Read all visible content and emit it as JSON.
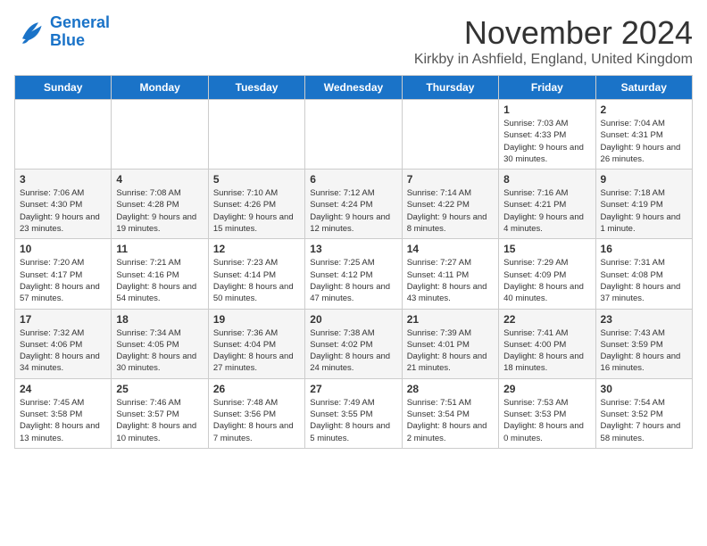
{
  "logo": {
    "line1": "General",
    "line2": "Blue"
  },
  "title": "November 2024",
  "subtitle": "Kirkby in Ashfield, England, United Kingdom",
  "days_of_week": [
    "Sunday",
    "Monday",
    "Tuesday",
    "Wednesday",
    "Thursday",
    "Friday",
    "Saturday"
  ],
  "weeks": [
    [
      {
        "day": "",
        "info": ""
      },
      {
        "day": "",
        "info": ""
      },
      {
        "day": "",
        "info": ""
      },
      {
        "day": "",
        "info": ""
      },
      {
        "day": "",
        "info": ""
      },
      {
        "day": "1",
        "info": "Sunrise: 7:03 AM\nSunset: 4:33 PM\nDaylight: 9 hours and 30 minutes."
      },
      {
        "day": "2",
        "info": "Sunrise: 7:04 AM\nSunset: 4:31 PM\nDaylight: 9 hours and 26 minutes."
      }
    ],
    [
      {
        "day": "3",
        "info": "Sunrise: 7:06 AM\nSunset: 4:30 PM\nDaylight: 9 hours and 23 minutes."
      },
      {
        "day": "4",
        "info": "Sunrise: 7:08 AM\nSunset: 4:28 PM\nDaylight: 9 hours and 19 minutes."
      },
      {
        "day": "5",
        "info": "Sunrise: 7:10 AM\nSunset: 4:26 PM\nDaylight: 9 hours and 15 minutes."
      },
      {
        "day": "6",
        "info": "Sunrise: 7:12 AM\nSunset: 4:24 PM\nDaylight: 9 hours and 12 minutes."
      },
      {
        "day": "7",
        "info": "Sunrise: 7:14 AM\nSunset: 4:22 PM\nDaylight: 9 hours and 8 minutes."
      },
      {
        "day": "8",
        "info": "Sunrise: 7:16 AM\nSunset: 4:21 PM\nDaylight: 9 hours and 4 minutes."
      },
      {
        "day": "9",
        "info": "Sunrise: 7:18 AM\nSunset: 4:19 PM\nDaylight: 9 hours and 1 minute."
      }
    ],
    [
      {
        "day": "10",
        "info": "Sunrise: 7:20 AM\nSunset: 4:17 PM\nDaylight: 8 hours and 57 minutes."
      },
      {
        "day": "11",
        "info": "Sunrise: 7:21 AM\nSunset: 4:16 PM\nDaylight: 8 hours and 54 minutes."
      },
      {
        "day": "12",
        "info": "Sunrise: 7:23 AM\nSunset: 4:14 PM\nDaylight: 8 hours and 50 minutes."
      },
      {
        "day": "13",
        "info": "Sunrise: 7:25 AM\nSunset: 4:12 PM\nDaylight: 8 hours and 47 minutes."
      },
      {
        "day": "14",
        "info": "Sunrise: 7:27 AM\nSunset: 4:11 PM\nDaylight: 8 hours and 43 minutes."
      },
      {
        "day": "15",
        "info": "Sunrise: 7:29 AM\nSunset: 4:09 PM\nDaylight: 8 hours and 40 minutes."
      },
      {
        "day": "16",
        "info": "Sunrise: 7:31 AM\nSunset: 4:08 PM\nDaylight: 8 hours and 37 minutes."
      }
    ],
    [
      {
        "day": "17",
        "info": "Sunrise: 7:32 AM\nSunset: 4:06 PM\nDaylight: 8 hours and 34 minutes."
      },
      {
        "day": "18",
        "info": "Sunrise: 7:34 AM\nSunset: 4:05 PM\nDaylight: 8 hours and 30 minutes."
      },
      {
        "day": "19",
        "info": "Sunrise: 7:36 AM\nSunset: 4:04 PM\nDaylight: 8 hours and 27 minutes."
      },
      {
        "day": "20",
        "info": "Sunrise: 7:38 AM\nSunset: 4:02 PM\nDaylight: 8 hours and 24 minutes."
      },
      {
        "day": "21",
        "info": "Sunrise: 7:39 AM\nSunset: 4:01 PM\nDaylight: 8 hours and 21 minutes."
      },
      {
        "day": "22",
        "info": "Sunrise: 7:41 AM\nSunset: 4:00 PM\nDaylight: 8 hours and 18 minutes."
      },
      {
        "day": "23",
        "info": "Sunrise: 7:43 AM\nSunset: 3:59 PM\nDaylight: 8 hours and 16 minutes."
      }
    ],
    [
      {
        "day": "24",
        "info": "Sunrise: 7:45 AM\nSunset: 3:58 PM\nDaylight: 8 hours and 13 minutes."
      },
      {
        "day": "25",
        "info": "Sunrise: 7:46 AM\nSunset: 3:57 PM\nDaylight: 8 hours and 10 minutes."
      },
      {
        "day": "26",
        "info": "Sunrise: 7:48 AM\nSunset: 3:56 PM\nDaylight: 8 hours and 7 minutes."
      },
      {
        "day": "27",
        "info": "Sunrise: 7:49 AM\nSunset: 3:55 PM\nDaylight: 8 hours and 5 minutes."
      },
      {
        "day": "28",
        "info": "Sunrise: 7:51 AM\nSunset: 3:54 PM\nDaylight: 8 hours and 2 minutes."
      },
      {
        "day": "29",
        "info": "Sunrise: 7:53 AM\nSunset: 3:53 PM\nDaylight: 8 hours and 0 minutes."
      },
      {
        "day": "30",
        "info": "Sunrise: 7:54 AM\nSunset: 3:52 PM\nDaylight: 7 hours and 58 minutes."
      }
    ]
  ]
}
